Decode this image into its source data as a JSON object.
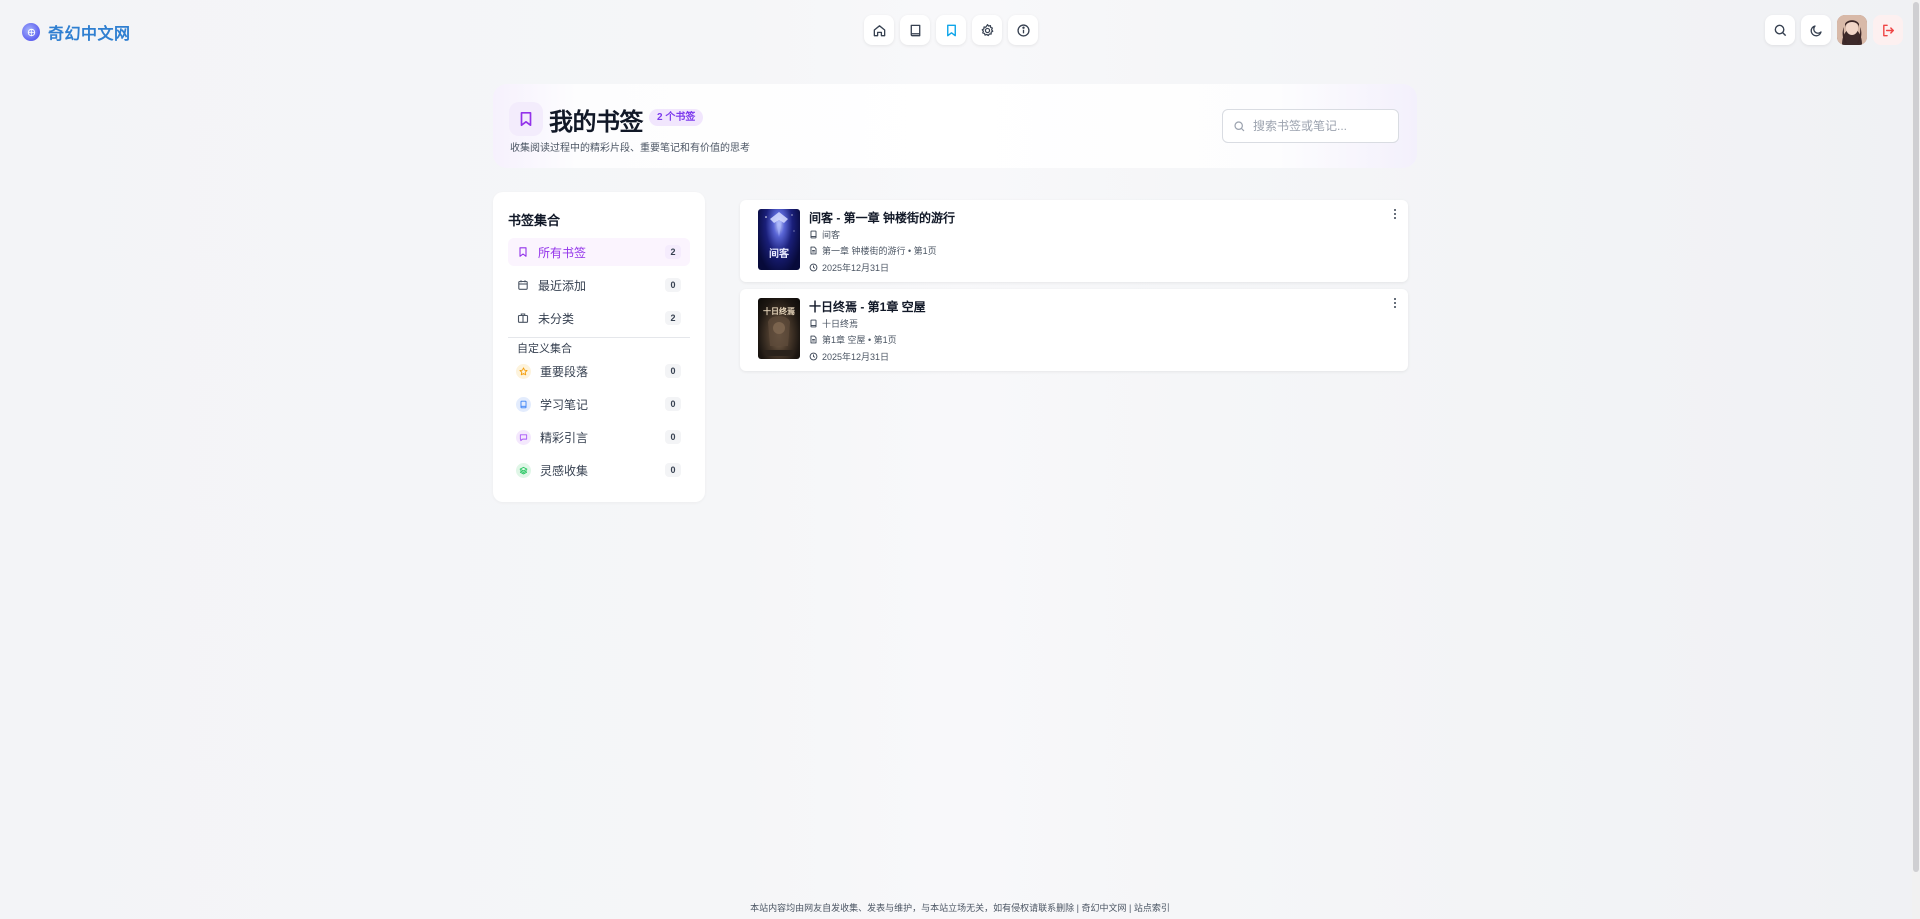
{
  "brand": {
    "name": "奇幻中文网",
    "logo_icon": "globe-icon"
  },
  "nav": {
    "items": [
      {
        "icon": "home-icon"
      },
      {
        "icon": "book-icon"
      },
      {
        "icon": "bookmark-icon",
        "active": true
      },
      {
        "icon": "gear-icon"
      },
      {
        "icon": "info-icon"
      }
    ]
  },
  "tools": {
    "search_icon": "search-icon",
    "theme_icon": "moon-icon",
    "logout_icon": "logout-icon"
  },
  "page": {
    "title": "我的书签",
    "badge": "2 个书签",
    "subtitle": "收集阅读过程中的精彩片段、重要笔记和有价值的思考",
    "search_placeholder": "搜索书签或笔记..."
  },
  "sidebar": {
    "title": "书签集合",
    "items": [
      {
        "label": "所有书签",
        "count": "2",
        "icon": "bookmark-icon",
        "active": true
      },
      {
        "label": "最近添加",
        "count": "0",
        "icon": "calendar-icon"
      },
      {
        "label": "未分类",
        "count": "2",
        "icon": "folder-icon"
      }
    ],
    "custom_title": "自定义集合",
    "custom_items": [
      {
        "label": "重要段落",
        "count": "0",
        "icon": "star-icon",
        "color": "#f59e0b",
        "bg": "#fdf3dc"
      },
      {
        "label": "学习笔记",
        "count": "0",
        "icon": "notebook-icon",
        "color": "#3b82f6",
        "bg": "#e3ecfd"
      },
      {
        "label": "精彩引言",
        "count": "0",
        "icon": "quote-icon",
        "color": "#a855f7",
        "bg": "#f4e8fd"
      },
      {
        "label": "灵感收集",
        "count": "0",
        "icon": "layers-icon",
        "color": "#22c55e",
        "bg": "#e0f6e7"
      }
    ]
  },
  "bookmarks": [
    {
      "title": "间客 - 第一章 钟楼街的游行",
      "book": "间客",
      "chapter": "第一章 钟楼街的游行 • 第1页",
      "date": "2025年12月31日",
      "cover_text": "间客"
    },
    {
      "title": "十日终焉 - 第1章 空屋",
      "book": "十日终焉",
      "chapter": "第1章 空屋 • 第1页",
      "date": "2025年12月31日",
      "cover_text": "十日终焉"
    }
  ],
  "footer": {
    "text": "本站内容均由网友自发收集、发表与维护，与本站立场无关，如有侵权请联系删除 | 奇幻中文网 | 站点索引"
  },
  "colors": {
    "accent": "#9333ea",
    "brand": "#2f7fd1",
    "danger": "#ef4444"
  }
}
